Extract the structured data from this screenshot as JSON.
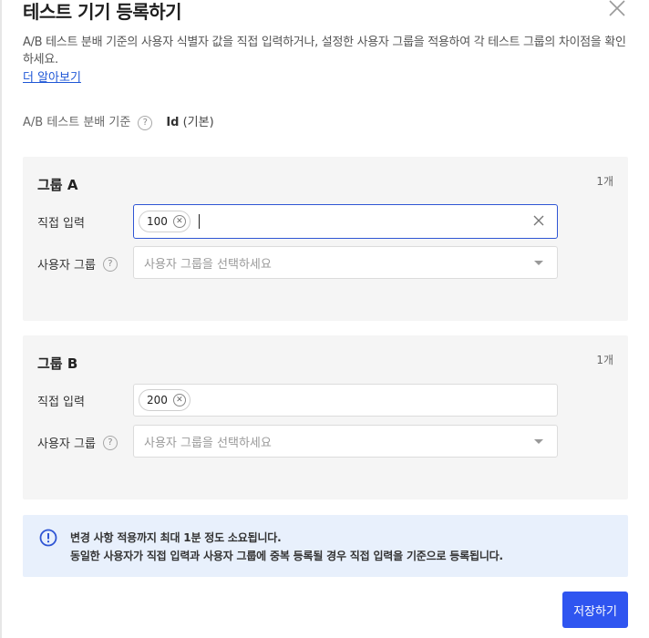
{
  "modal": {
    "title": "테스트 기기 등록하기",
    "description": "A/B 테스트 분배 기준의 사용자 식별자 값을 직접 입력하거나, 설정한 사용자 그룹을 적용하여 각 테스트 그룹의 차이점을 확인하세요.",
    "learn_more": "더 알아보기",
    "close_icon": "close-icon"
  },
  "criteria": {
    "label": "A/B 테스트 분배 기준",
    "help": "?",
    "value_bold": "Id",
    "value_suffix": "(기본)"
  },
  "groups": [
    {
      "title": "그룹 A",
      "count": "1개",
      "direct_label": "직접 입력",
      "chips": [
        "100"
      ],
      "user_group_label": "사용자 그룹",
      "user_group_placeholder": "사용자 그룹을 선택하세요"
    },
    {
      "title": "그룹 B",
      "count": "1개",
      "direct_label": "직접 입력",
      "chips": [
        "200"
      ],
      "user_group_label": "사용자 그룹",
      "user_group_placeholder": "사용자 그룹을 선택하세요"
    }
  ],
  "notice": {
    "line1": "변경 사항 적용까지 최대 1분 정도 소요됩니다.",
    "line2": "동일한 사용자가 직접 입력과 사용자 그룹에 중복 등록될 경우 직접 입력을 기준으로 등록됩니다.",
    "icon": "info-icon"
  },
  "footer": {
    "save_label": "저장하기"
  },
  "colors": {
    "accent": "#2f55f0",
    "link": "#1f57d6",
    "notice_bg": "#e8f0fc",
    "group_bg": "#f5f5f5"
  }
}
